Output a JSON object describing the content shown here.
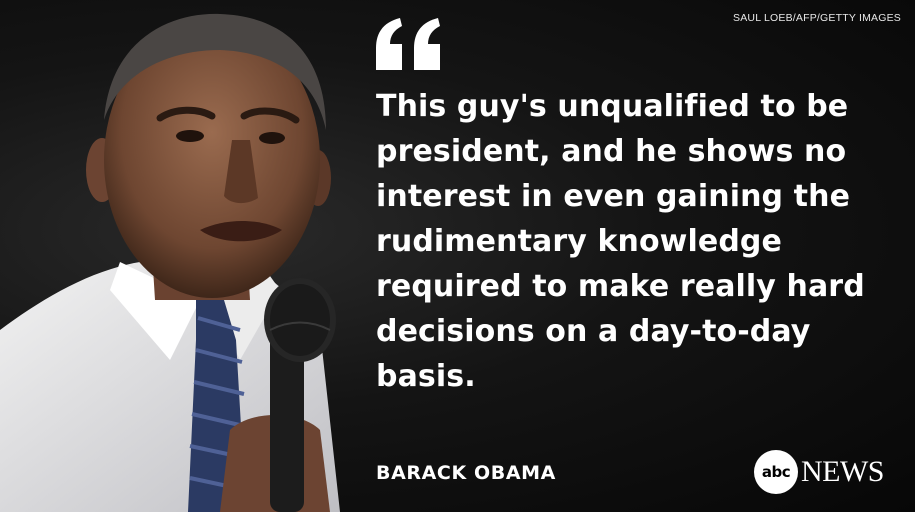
{
  "credit": "SAUL LOEB/AFP/GETTY IMAGES",
  "quote": {
    "lines": [
      "This guy's unqualified to be",
      "president, and he shows no",
      "interest in even gaining the",
      "rudimentary knowledge",
      "required to make really hard",
      "decisions on a day-to-day",
      "basis."
    ],
    "icon": "quotation-mark-icon"
  },
  "speaker": "BARACK OBAMA",
  "logo": {
    "circle": "abc",
    "word": "NEWS"
  },
  "colors": {
    "background": "#0b0b0b",
    "text": "#ffffff"
  }
}
